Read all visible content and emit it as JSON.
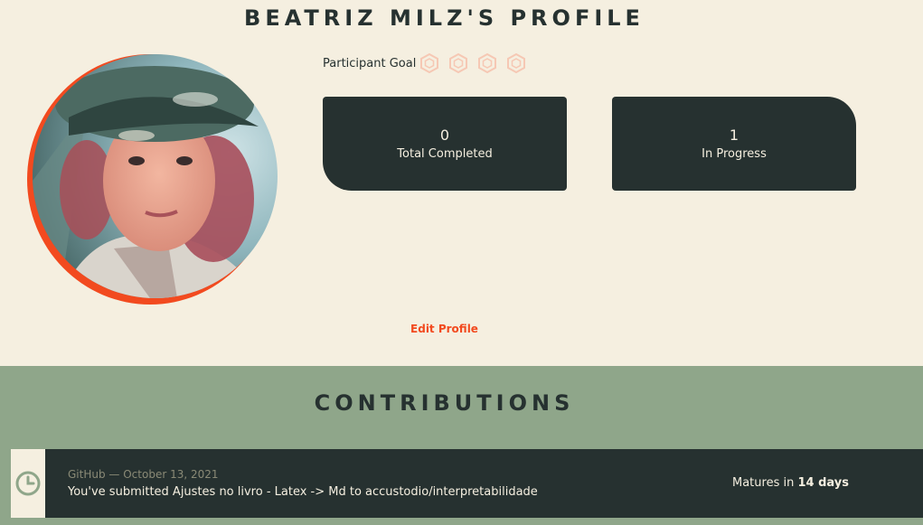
{
  "header": {
    "title": "BEATRIZ MILZ'S PROFILE"
  },
  "profile": {
    "avatar_alt": "Beatriz Milz profile photo",
    "goal_label": "Participant Goal",
    "goal_icons": [
      "hexagon-badge-icon",
      "hexagon-badge-icon",
      "hexagon-badge-icon",
      "hexagon-badge-icon"
    ],
    "goal_level": 0,
    "edit_label": "Edit Profile"
  },
  "stats": [
    {
      "value": "0",
      "label": "Total Completed"
    },
    {
      "value": "1",
      "label": "In Progress"
    }
  ],
  "contributions": {
    "title": "CONTRIBUTIONS",
    "items": [
      {
        "source": "GitHub",
        "separator": " — ",
        "date": "October 13, 2021",
        "text": "You've submitted Ajustes no livro - Latex -> Md to accustodio/interpretabilidade",
        "matures_prefix": "Matures in ",
        "matures_value": "14 days",
        "icon": "clock-icon"
      }
    ]
  },
  "colors": {
    "background": "#f5efe0",
    "dark": "#263130",
    "accent": "#f24a1f",
    "band": "#8fa68a",
    "hex_inactive": "#f6c8b4"
  }
}
